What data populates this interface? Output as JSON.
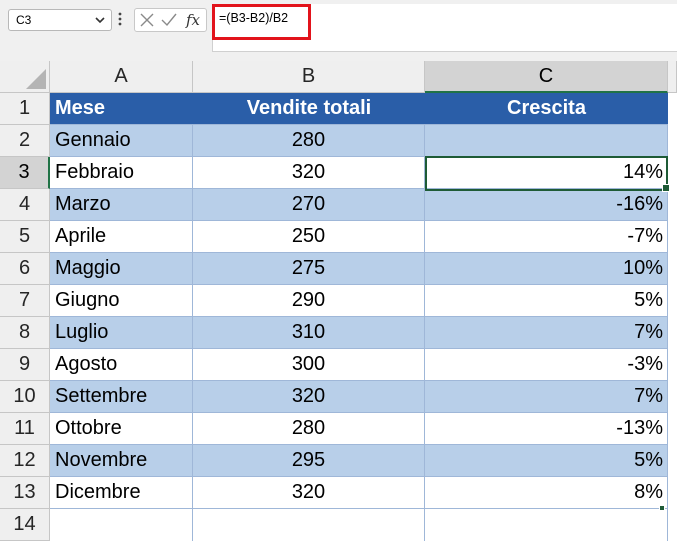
{
  "name_box": {
    "value": "C3"
  },
  "formula_bar": {
    "formula": "=(B3-B2)/B2",
    "fx_label": "fx"
  },
  "columns": [
    "A",
    "B",
    "C"
  ],
  "selected_column": "C",
  "selected_row": "3",
  "rows": [
    {
      "num": "1",
      "a": "Mese",
      "b": "Vendite totali",
      "c": "Crescita"
    },
    {
      "num": "2",
      "a": "Gennaio",
      "b": "280",
      "c": ""
    },
    {
      "num": "3",
      "a": "Febbraio",
      "b": "320",
      "c": "14%"
    },
    {
      "num": "4",
      "a": "Marzo",
      "b": "270",
      "c": "-16%"
    },
    {
      "num": "5",
      "a": "Aprile",
      "b": "250",
      "c": "-7%"
    },
    {
      "num": "6",
      "a": "Maggio",
      "b": "275",
      "c": "10%"
    },
    {
      "num": "7",
      "a": "Giugno",
      "b": "290",
      "c": "5%"
    },
    {
      "num": "8",
      "a": "Luglio",
      "b": "310",
      "c": "7%"
    },
    {
      "num": "9",
      "a": "Agosto",
      "b": "300",
      "c": "-3%"
    },
    {
      "num": "10",
      "a": "Settembre",
      "b": "320",
      "c": "7%"
    },
    {
      "num": "11",
      "a": "Ottobre",
      "b": "280",
      "c": "-13%"
    },
    {
      "num": "12",
      "a": "Novembre",
      "b": "295",
      "c": "5%"
    },
    {
      "num": "13",
      "a": "Dicembre",
      "b": "320",
      "c": "8%"
    },
    {
      "num": "14",
      "a": "",
      "b": "",
      "c": ""
    }
  ],
  "colors": {
    "header_fill": "#2a5ea8",
    "band_fill": "#b8cfe9",
    "selection": "#1e5b36",
    "highlight_box": "#e2131b"
  }
}
